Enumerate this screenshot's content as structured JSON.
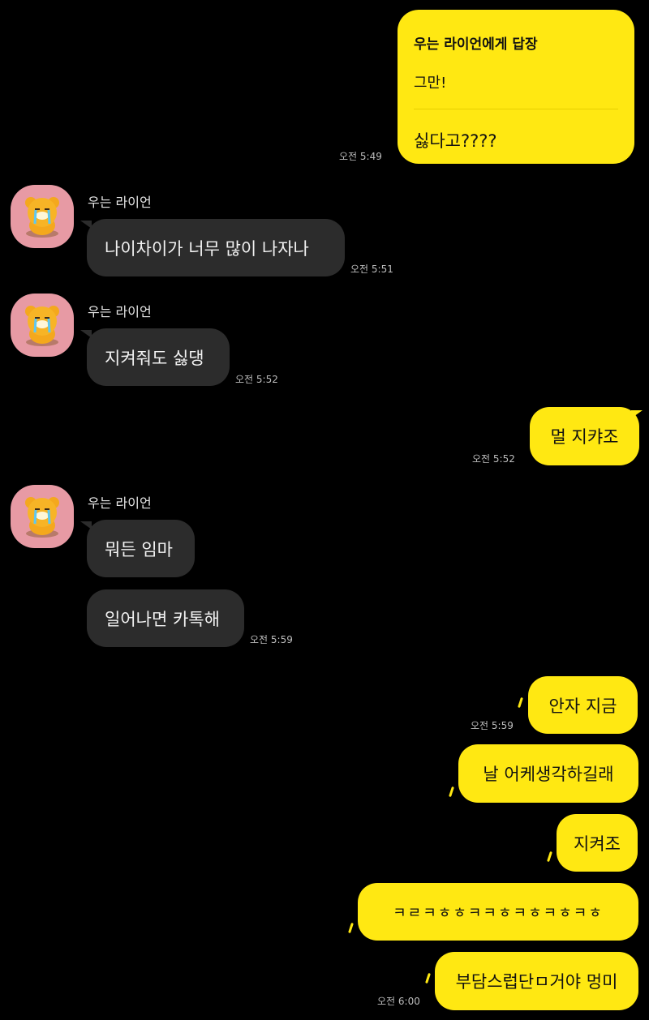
{
  "messages": {
    "m1": {
      "reply_title": "우는 라이언에게 답장",
      "reply_quote": "그만!",
      "text": "싫다고????",
      "time": "오전 5:49"
    },
    "g1": {
      "sender": "우는 라이언",
      "text": "나이차이가 너무 많이 나자나",
      "time": "오전 5:51"
    },
    "g2": {
      "sender": "우는 라이언",
      "text": "지켜줘도 싫댕",
      "time": "오전 5:52"
    },
    "m2": {
      "text": "멀 지캬조",
      "time": "오전 5:52"
    },
    "g3": {
      "sender": "우는 라이언",
      "text1": "뭐든 임마",
      "text2": "일어나면 카톡해",
      "time": "오전 5:59"
    },
    "m3": {
      "text": "안자 지금",
      "time": "오전 5:59"
    },
    "m4": {
      "text": "날 어케생각하길래"
    },
    "m5": {
      "text": "지켜조"
    },
    "m6": {
      "text": "ㅋㄹㅋㅎㅎㅋㅋㅎㅋㅎㅋㅎㅋㅎ"
    },
    "m7": {
      "text": "부담스럽단ㅁ거야 멍미",
      "time": "오전 6:00"
    }
  },
  "colors": {
    "my_bubble": "#ffe812",
    "their_bubble": "#2c2c2c",
    "background": "#000000",
    "avatar_bg": "#e79aa4"
  },
  "icons": {
    "avatar": "crying-ryan-avatar-icon"
  }
}
